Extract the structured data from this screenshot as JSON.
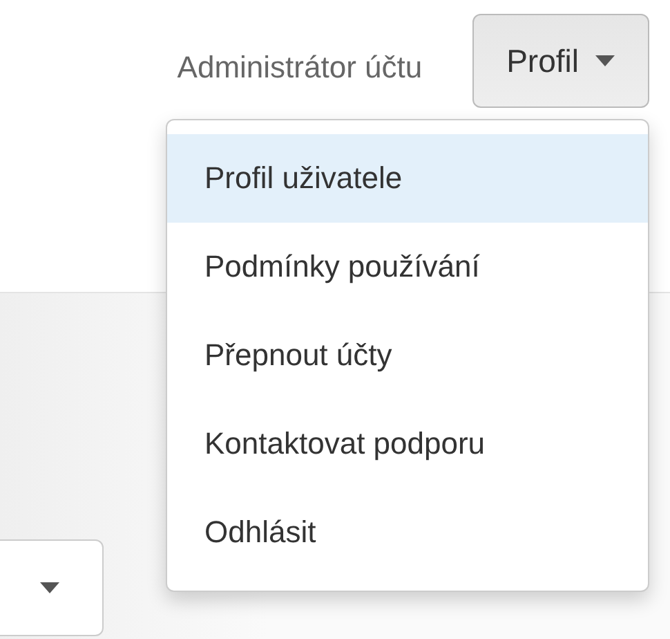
{
  "header": {
    "role_label": "Administrátor účtu",
    "profile_button": {
      "label": "Profil",
      "expanded": true
    }
  },
  "menu": {
    "items": [
      {
        "label": "Profil uživatele",
        "selected": true
      },
      {
        "label": "Podmínky používání",
        "selected": false
      },
      {
        "label": "Přepnout účty",
        "selected": false
      },
      {
        "label": "Kontaktovat podporu",
        "selected": false
      },
      {
        "label": "Odhlásit",
        "selected": false
      }
    ]
  }
}
